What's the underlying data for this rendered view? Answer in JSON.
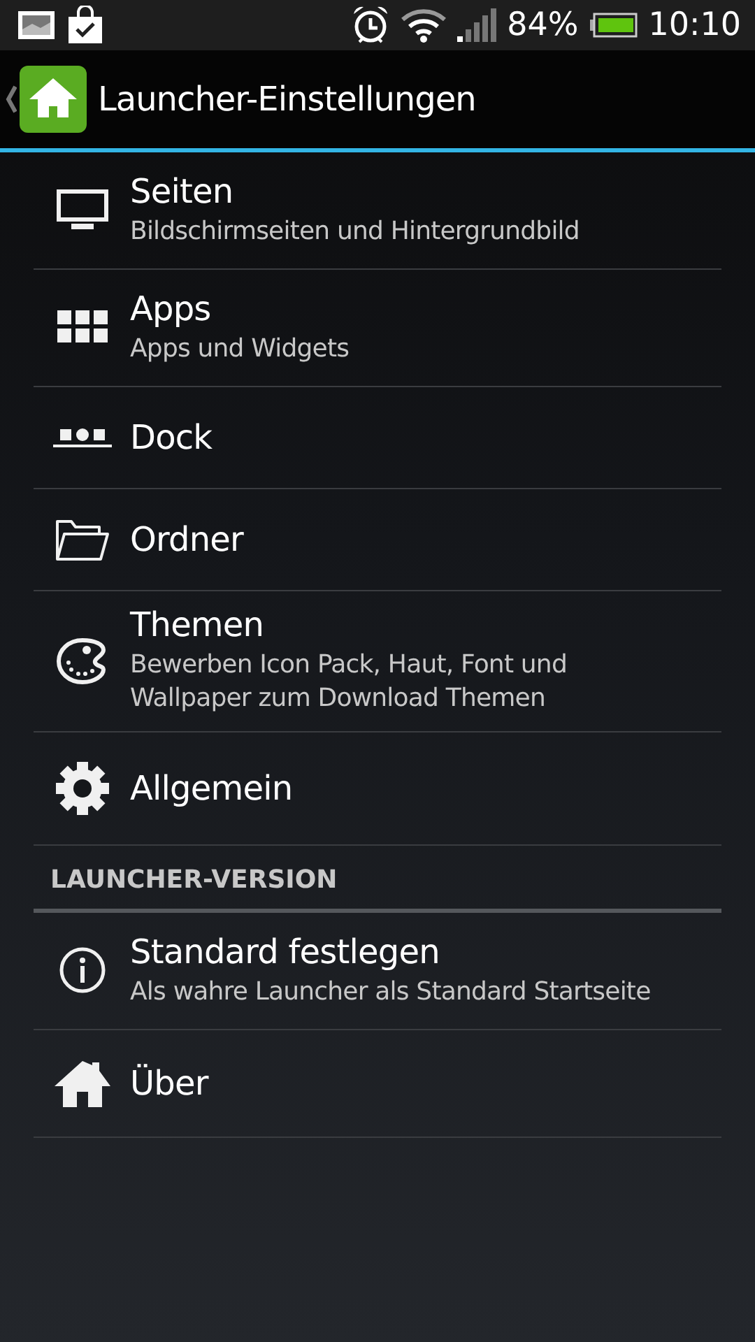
{
  "status_bar": {
    "battery": "84%",
    "time": "10:10"
  },
  "action_bar": {
    "title": "Launcher-Einstellungen"
  },
  "groups": [
    {
      "items": [
        {
          "title": "Seiten",
          "summary": "Bildschirmseiten und Hintergrundbild"
        },
        {
          "title": "Apps",
          "summary": "Apps und Widgets"
        },
        {
          "title": "Dock"
        },
        {
          "title": "Ordner"
        },
        {
          "title": "Themen",
          "summary": "Bewerben Icon Pack, Haut, Font und Wallpaper zum Download Themen"
        },
        {
          "title": "Allgemein"
        }
      ]
    },
    {
      "header": "LAUNCHER-VERSION",
      "items": [
        {
          "title": "Standard festlegen",
          "summary": "Als wahre Launcher als Standard Startseite"
        },
        {
          "title": "Über"
        }
      ]
    }
  ]
}
